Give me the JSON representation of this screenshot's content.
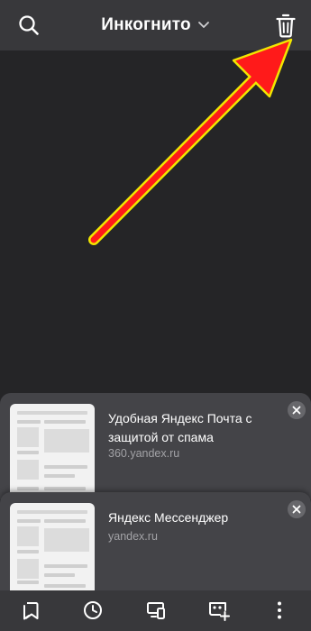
{
  "header": {
    "title": "Инкогнито",
    "left_icon": "search-icon",
    "title_icon": "chevron-down-icon",
    "right_icon": "trash-icon"
  },
  "annotation": {
    "type": "arrow",
    "color": "#ff1a1a",
    "outline": "#f2e600",
    "points_to": "trash-button"
  },
  "suggestions": [
    {
      "title": "Удобная Яндекс Почта с защитой от спама",
      "url": "360.yandex.ru",
      "close_icon": "close-icon"
    },
    {
      "title": "Яндекс Мессенджер",
      "url": "yandex.ru",
      "close_icon": "close-icon"
    }
  ],
  "bottom_bar": {
    "items": [
      {
        "icon": "bookmarks-icon"
      },
      {
        "icon": "history-icon"
      },
      {
        "icon": "devices-icon"
      },
      {
        "icon": "new-incognito-tab-icon"
      },
      {
        "icon": "more-vertical-icon"
      }
    ]
  },
  "colors": {
    "background": "#252527",
    "bars": "#38383b",
    "card": "#444448",
    "text": "#ffffff",
    "muted_text": "#a2a2a6"
  }
}
